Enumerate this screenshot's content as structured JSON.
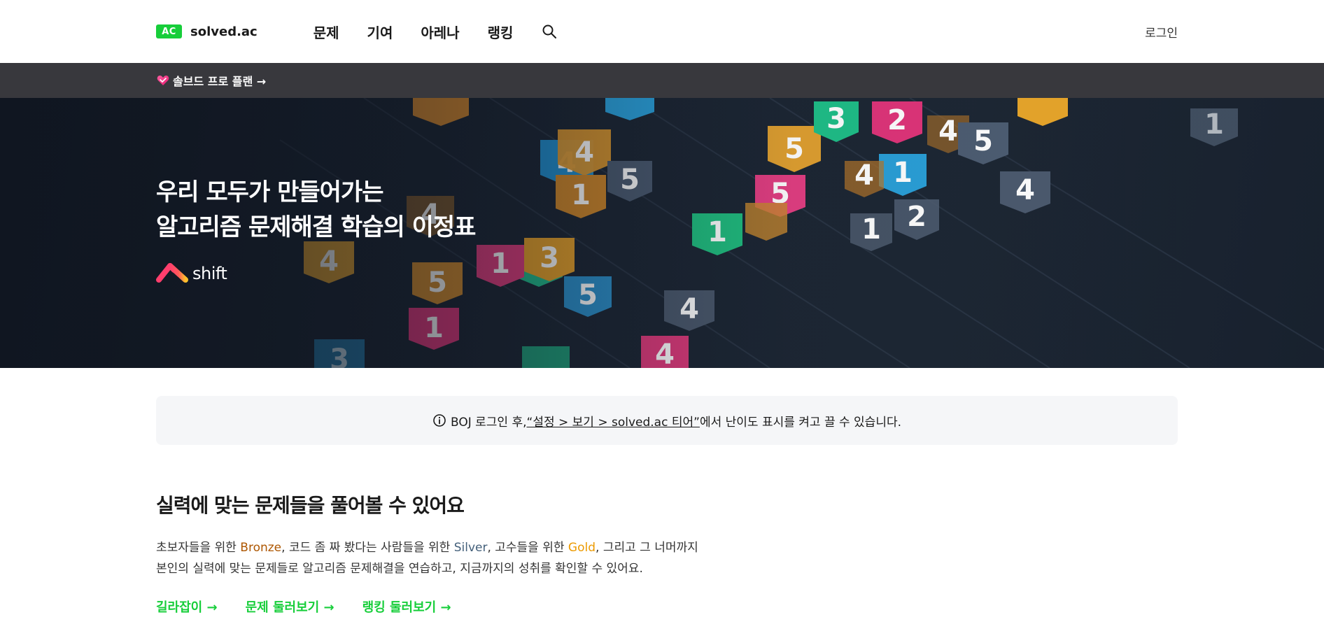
{
  "header": {
    "logo_badge": "AC",
    "logo_text": "solved.ac",
    "nav": [
      "문제",
      "기여",
      "아레나",
      "랭킹"
    ],
    "login_label": "로그인"
  },
  "promo": {
    "label": "솔브드 프로 플랜 →"
  },
  "hero": {
    "title_line1": "우리 모두가 만들어가는",
    "title_line2": "알고리즘 문제해결 학습의 이정표",
    "brand": "shift"
  },
  "notice": {
    "text_before": "BOJ 로그인 후, ",
    "link_text": "“설정 > 보기 > solved.ac 티어”",
    "text_after": "에서 난이도 표시를 켜고 끌 수 있습니다."
  },
  "section": {
    "title": "실력에 맞는 문제들을 풀어볼 수 있어요",
    "desc_1": "초보자들을 위한 ",
    "bronze": "Bronze",
    "desc_2": ", 코드 좀 짜 봤다는 사람들을 위한 ",
    "silver": "Silver",
    "desc_3": ", 고수들을 위한 ",
    "gold": "Gold",
    "desc_4": ", 그리고 그 너머까지",
    "desc_line2": "본인의 실력에 맞는 문제들로 알고리즘 문제해결을 연습하고, 지금까지의 성취를 확인할 수 있어요.",
    "links": [
      "길라잡이 →",
      "문제 둘러보기 →",
      "랭킹 둘러보기 →"
    ]
  },
  "colors": {
    "accent": "#17ce3a",
    "promo_bg": "#38383d",
    "bronze": "#ad5600",
    "silver": "#435f7a",
    "gold": "#ec9a00"
  }
}
